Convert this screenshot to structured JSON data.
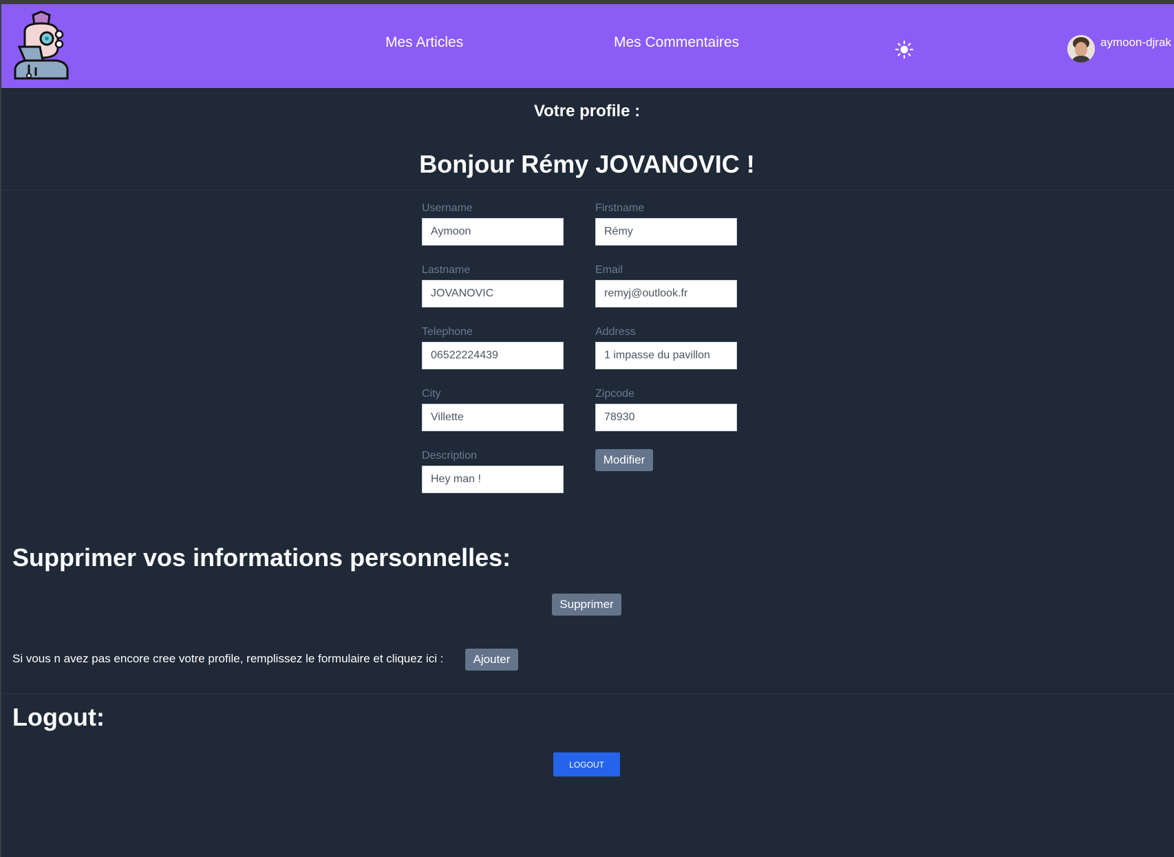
{
  "header": {
    "nav": {
      "articles": "Mes Articles",
      "comments": "Mes Commentaires"
    },
    "theme_icon": "sun-icon",
    "user": {
      "username": "aymoon-djrak"
    }
  },
  "profile": {
    "heading": "Votre profile :",
    "greeting": "Bonjour Rémy JOVANOVIC !",
    "fields": {
      "username": {
        "label": "Username",
        "value": "Aymoon"
      },
      "firstname": {
        "label": "Firstname",
        "value": "Rémy"
      },
      "lastname": {
        "label": "Lastname",
        "value": "JOVANOVIC"
      },
      "email": {
        "label": "Email",
        "value": "remyj@outlook.fr"
      },
      "telephone": {
        "label": "Telephone",
        "value": "06522224439"
      },
      "address": {
        "label": "Address",
        "value": "1 impasse du pavillon"
      },
      "city": {
        "label": "City",
        "value": "Villette"
      },
      "zipcode": {
        "label": "Zipcode",
        "value": "78930"
      },
      "description": {
        "label": "Description",
        "value": "Hey man !"
      }
    },
    "modify_label": "Modifier"
  },
  "delete_section": {
    "heading": "Supprimer vos informations personnelles:",
    "button_label": "Supprimer"
  },
  "create_section": {
    "text": "Si vous n avez pas encore cree votre profile, remplissez le formulaire et cliquez ici :",
    "button_label": "Ajouter"
  },
  "logout_section": {
    "heading": "Logout:",
    "button_label": "LOGOUT"
  },
  "colors": {
    "header_bg": "#8b5cf6",
    "page_bg": "#1f2937",
    "logout_button": "#2563eb",
    "secondary_button": "#64748b"
  }
}
